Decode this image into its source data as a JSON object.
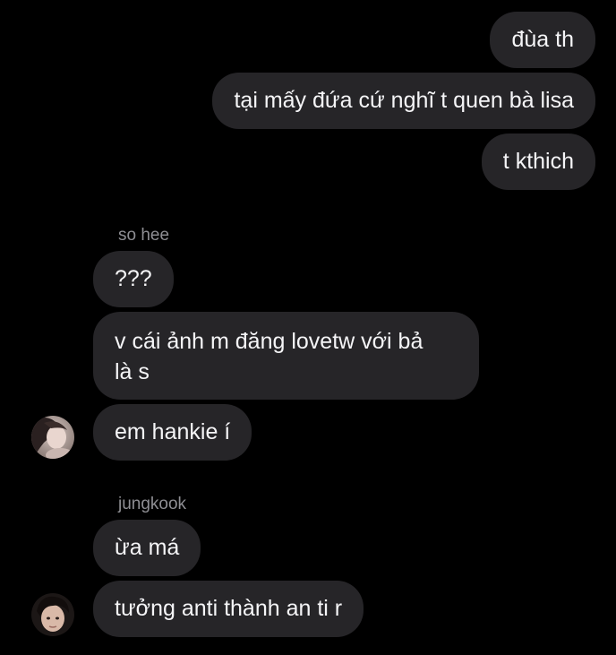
{
  "conversation": {
    "outgoing": [
      {
        "text": "đùa th"
      },
      {
        "text": "tại mấy đứa cứ nghĩ t quen bà lisa"
      },
      {
        "text": "t kthich"
      }
    ],
    "group1": {
      "sender": "so hee",
      "messages": [
        {
          "text": "???"
        },
        {
          "line1": "v cái ảnh m đăng lovetw với bả",
          "line2": "là s"
        },
        {
          "text": "em hankie í"
        }
      ],
      "avatar_icon": "profile-photo-so-hee"
    },
    "group2": {
      "sender": "jungkook",
      "messages": [
        {
          "text": "ừa má"
        },
        {
          "text": "tưởng anti thành an ti r"
        }
      ],
      "avatar_icon": "profile-photo-jungkook"
    }
  },
  "colors": {
    "background": "#000000",
    "bubble": "#262528",
    "text": "#f5f5f7",
    "sender": "#8e8e93"
  }
}
